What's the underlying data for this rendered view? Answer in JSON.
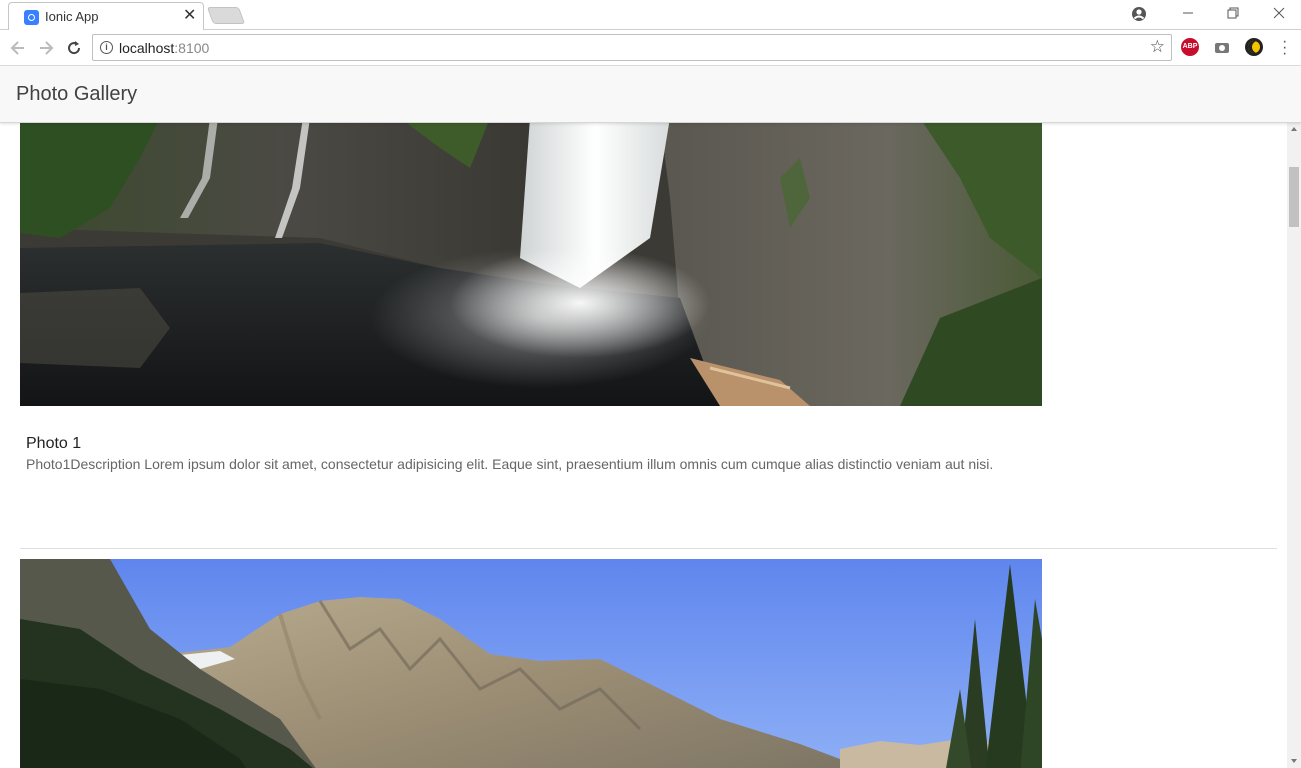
{
  "browser": {
    "tab_title": "Ionic App",
    "tab_close": "✕",
    "url_host": "localhost",
    "url_port": ":8100",
    "abp_label": "ABP",
    "back_icon": "arrow-left-icon",
    "forward_icon": "arrow-right-icon",
    "reload_icon": "reload-icon"
  },
  "app": {
    "title": "Photo Gallery",
    "header_color": "#f8f8f8"
  },
  "photos": [
    {
      "title": "Photo 1",
      "description": "Photo1Description Lorem ipsum dolor sit amet, consectetur adipisicing elit. Eaque sint, praesentium illum omnis cum cumque alias distinctio veniam aut nisi."
    }
  ]
}
